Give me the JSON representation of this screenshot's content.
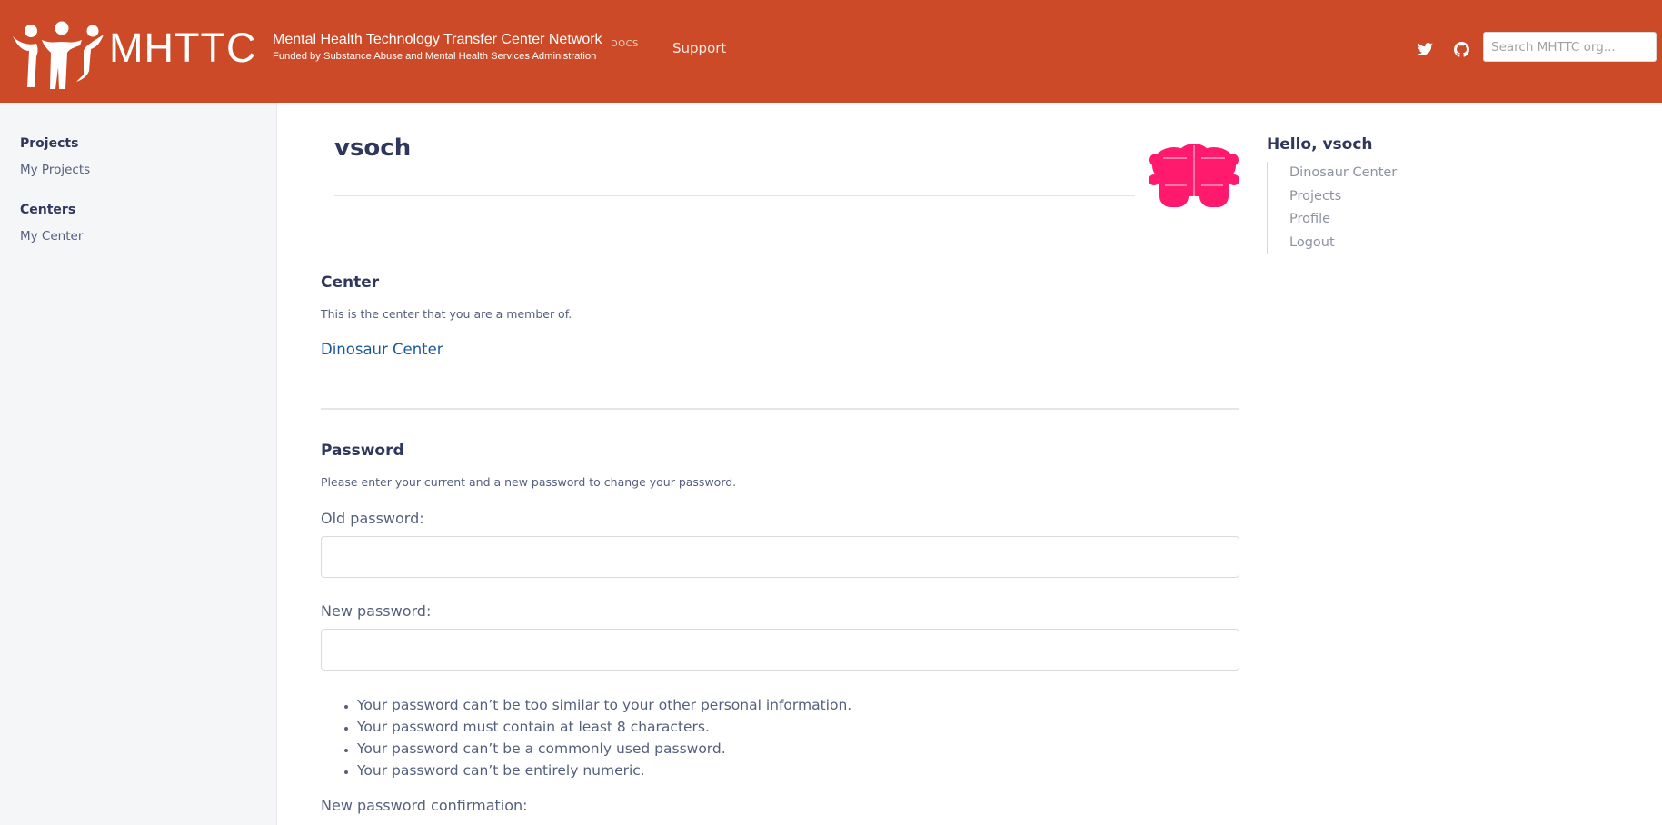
{
  "header": {
    "logo_text": "MHTTC",
    "brand_title": "Mental Health Technology Transfer Center Network",
    "brand_subtitle": "Funded by Substance Abuse and Mental Health Services Administration",
    "docs_badge": "DOCS",
    "nav_support": "Support",
    "search_placeholder": "Search MHTTC org...",
    "icons": [
      "twitter-icon",
      "github-icon"
    ],
    "brand_color": "#cc4a27"
  },
  "sidebar": {
    "sections": [
      {
        "heading": "Projects",
        "link": "My Projects"
      },
      {
        "heading": "Centers",
        "link": "My Center"
      }
    ]
  },
  "main": {
    "username": "vsoch",
    "avatar_color": "#ff1a6e",
    "center": {
      "title": "Center",
      "description": "This is the center that you are a member of.",
      "link": "Dinosaur Center"
    },
    "password": {
      "title": "Password",
      "description": "Please enter your current and a new password to change your password.",
      "old_label": "Old password:",
      "new_label": "New password:",
      "confirm_label": "New password confirmation:",
      "rules": [
        "Your password can’t be too similar to your other personal information.",
        "Your password must contain at least 8 characters.",
        "Your password can’t be a commonly used password.",
        "Your password can’t be entirely numeric."
      ]
    }
  },
  "right_panel": {
    "greeting": "Hello, vsoch",
    "links": [
      "Dinosaur Center",
      "Projects",
      "Profile",
      "Logout"
    ]
  }
}
